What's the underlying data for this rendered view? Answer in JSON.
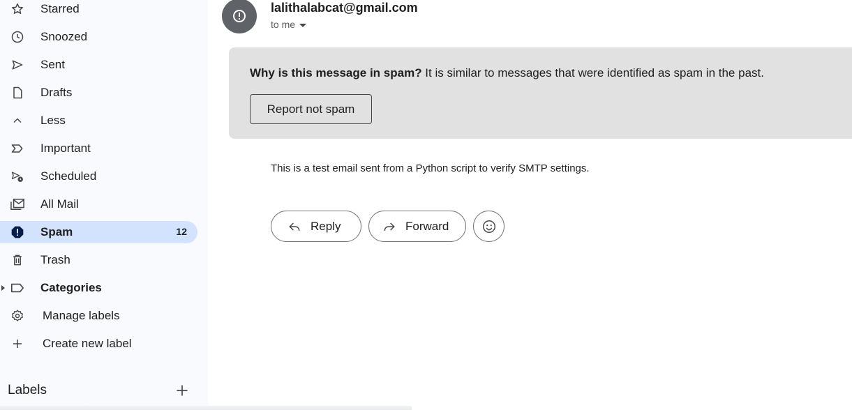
{
  "sidebar": {
    "items": [
      {
        "label": "Starred",
        "icon": "star-icon"
      },
      {
        "label": "Snoozed",
        "icon": "clock-icon"
      },
      {
        "label": "Sent",
        "icon": "send-icon"
      },
      {
        "label": "Drafts",
        "icon": "draft-icon"
      },
      {
        "label": "Less",
        "icon": "chevron-up-icon"
      },
      {
        "label": "Important",
        "icon": "important-icon"
      },
      {
        "label": "Scheduled",
        "icon": "scheduled-icon"
      },
      {
        "label": "All Mail",
        "icon": "all-mail-icon"
      },
      {
        "label": "Spam",
        "icon": "spam-icon",
        "count": "12"
      },
      {
        "label": "Trash",
        "icon": "trash-icon"
      },
      {
        "label": "Categories",
        "icon": "label-icon"
      },
      {
        "label": "Manage labels",
        "icon": "gear-icon"
      },
      {
        "label": "Create new label",
        "icon": "plus-icon"
      }
    ],
    "labels_heading": "Labels"
  },
  "message": {
    "sender": "lalithalabcat@gmail.com",
    "recipient": "to me",
    "spam_question": "Why is this message in spam?",
    "spam_reason": " It is similar to messages that were identified as spam in the past.",
    "report_button": "Report not spam",
    "body": "This is a test email sent from a Python script to verify SMTP settings.",
    "reply_label": "Reply",
    "forward_label": "Forward"
  },
  "colors": {
    "active_nav": "#d3e3fd",
    "spam_banner": "#e1e1e1",
    "sidebar_bg": "#f8fafd",
    "avatar": "#5f6368"
  }
}
